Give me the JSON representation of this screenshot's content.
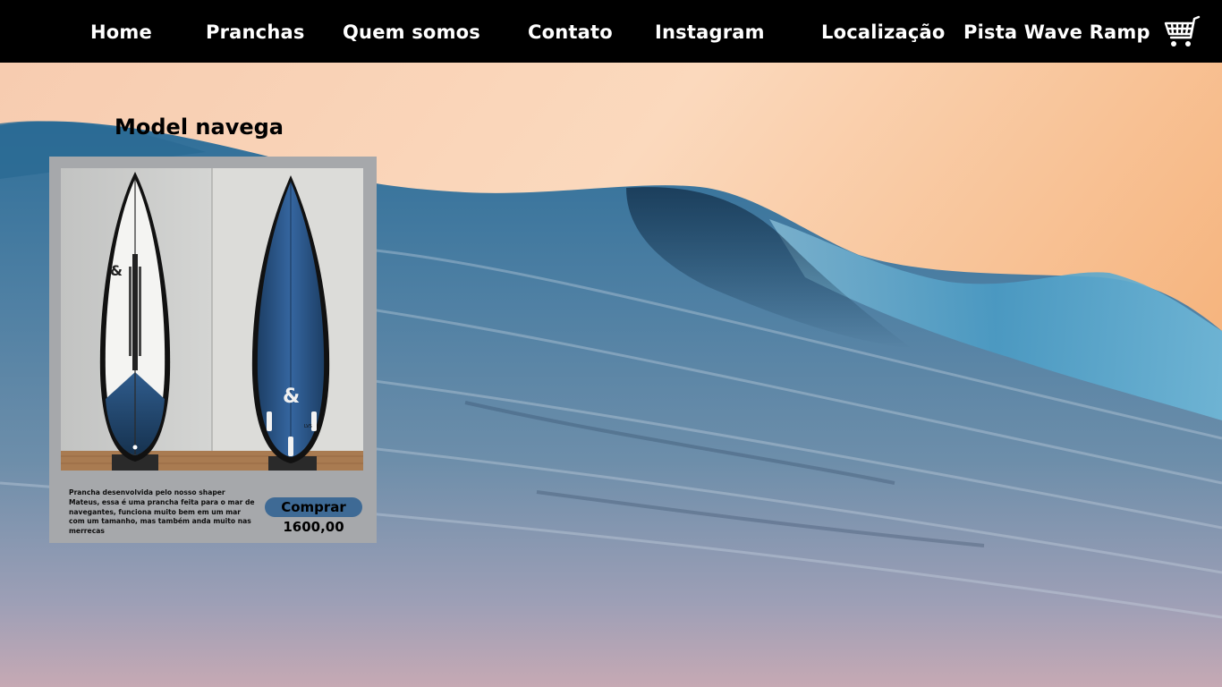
{
  "nav": {
    "home": "Home",
    "pranchas": "Pranchas",
    "quem_somos": "Quem somos",
    "contato": "Contato",
    "instagram": "Instagram",
    "localizacao": "Localização",
    "pista": "Pista Wave Ramp",
    "cart_icon": "shopping-cart-icon"
  },
  "product": {
    "title": "Model navega",
    "description": "Prancha desenvolvida pelo nosso shaper Mateus, essa é uma prancha feita para o mar de navegantes, funciona muito bem em um mar com um tamanho, mas também anda muito nas merrecas",
    "buy_label": "Comprar",
    "price": "1600,00"
  },
  "colors": {
    "nav_background": "#000000",
    "card_background": "#a6a8ab",
    "button": "#3e6a95",
    "board_blue": "#2c5c8f"
  }
}
